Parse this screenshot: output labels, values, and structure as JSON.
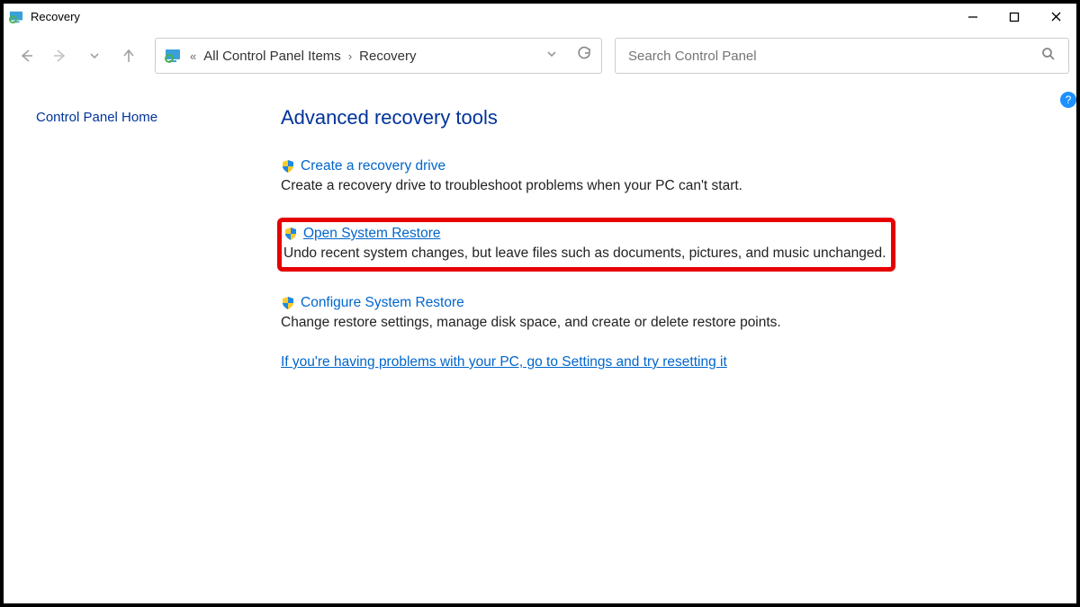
{
  "window": {
    "title": "Recovery"
  },
  "breadcrumb": {
    "parent": "All Control Panel Items",
    "current": "Recovery"
  },
  "search": {
    "placeholder": "Search Control Panel"
  },
  "sidebar": {
    "home": "Control Panel Home"
  },
  "main": {
    "heading": "Advanced recovery tools",
    "tools": [
      {
        "title": "Create a recovery drive",
        "desc": "Create a recovery drive to troubleshoot problems when your PC can't start."
      },
      {
        "title": "Open System Restore",
        "desc": "Undo recent system changes, but leave files such as documents, pictures, and music unchanged."
      },
      {
        "title": "Configure System Restore",
        "desc": "Change restore settings, manage disk space, and create or delete restore points."
      }
    ],
    "footer_link": "If you're having problems with your PC, go to Settings and try resetting it"
  },
  "help_badge": "?"
}
